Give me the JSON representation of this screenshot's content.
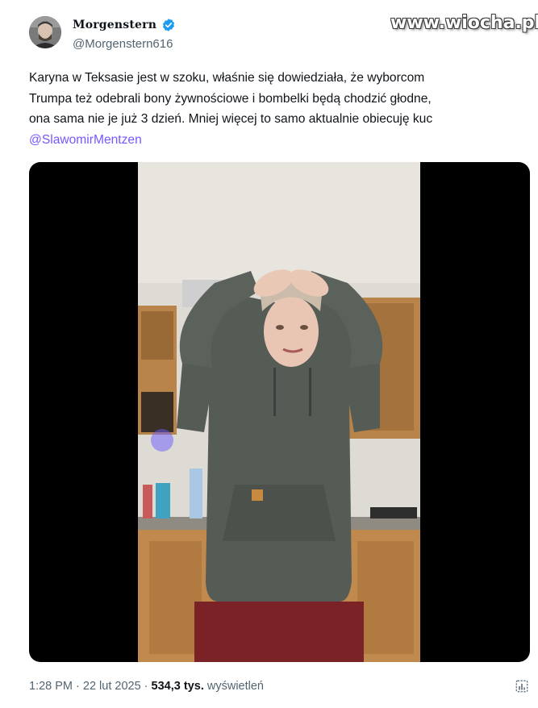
{
  "author": {
    "name": "Morgenstern",
    "handle": "@Morgenstern616",
    "verified": true
  },
  "watermark": "www.wiocha.pl",
  "tweet": {
    "lines": [
      "Karyna w Teksasie jest w szoku, właśnie się dowiedziała, że wyborcom",
      "Trumpa też odebrali bony żywnościowe i bombelki będą chodzić głodne,",
      "ona sama nie je już 3 dzień. Mniej więcej to samo aktualnie obiecuję kuc"
    ],
    "mention": "@SlawomirMentzen"
  },
  "footer": {
    "time": "1:28 PM",
    "sep1": " · ",
    "date": "22 lut 2025",
    "sep2": " · ",
    "views": "534,3 tys.",
    "views_label": " wyświetleń"
  },
  "icons": {
    "verified": "verified-badge-icon",
    "analytics": "analytics-icon"
  },
  "colors": {
    "mention": "#7856ff",
    "verified": "#1d9bf0",
    "secondary_text": "#536471"
  }
}
